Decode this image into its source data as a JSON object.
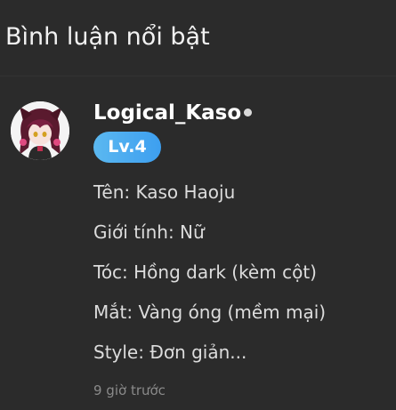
{
  "section": {
    "title": "Bình luận nổi bật"
  },
  "comment": {
    "username": "Logical_Kaso",
    "level": "Lv.4",
    "lines": [
      "Tên: Kaso Haoju",
      "Giới tính: Nữ",
      "Tóc: Hồng dark (kèm cột)",
      "Mắt: Vàng óng (mềm mại)",
      "Style: Đơn giản..."
    ],
    "timestamp": "9 giờ trước"
  },
  "colors": {
    "background": "#2b2b2b",
    "level_badge": "#4aa8f0",
    "text_primary": "#ffffff",
    "text_secondary": "#dcdcdc",
    "text_muted": "#8a8a8a"
  }
}
